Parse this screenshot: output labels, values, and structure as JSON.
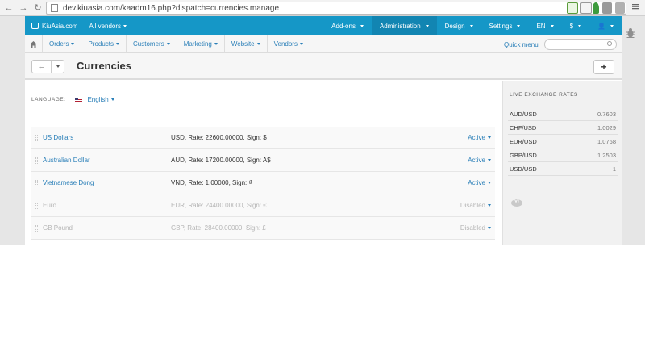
{
  "browser": {
    "url": "dev.kiuasia.com/kaadm16.php?dispatch=currencies.manage",
    "back_glyph": "←",
    "forward_glyph": "→",
    "reload_glyph": "↻"
  },
  "topbar": {
    "store_name": "KiuAsia.com",
    "vendors_label": "All vendors",
    "menus": [
      {
        "label": "Add-ons"
      },
      {
        "label": "Administration"
      },
      {
        "label": "Design"
      },
      {
        "label": "Settings"
      },
      {
        "label": "EN"
      },
      {
        "label": "$"
      },
      {
        "label": "👤"
      }
    ],
    "active_color": "#1285b2",
    "bar_color": "#1597c7"
  },
  "subnav": {
    "items": [
      {
        "label": "Orders"
      },
      {
        "label": "Products"
      },
      {
        "label": "Customers"
      },
      {
        "label": "Marketing"
      },
      {
        "label": "Website"
      },
      {
        "label": "Vendors"
      }
    ],
    "quick_menu": "Quick menu"
  },
  "page": {
    "title": "Currencies",
    "back_glyph": "←",
    "add_glyph": "+"
  },
  "language": {
    "label": "LANGUAGE:",
    "value": "English"
  },
  "currencies": [
    {
      "name": "US Dollars",
      "details": "USD, Rate: 22600.00000, Sign: $",
      "status": "Active"
    },
    {
      "name": "Australian Dollar",
      "details": "AUD, Rate: 17200.00000, Sign: A$",
      "status": "Active"
    },
    {
      "name": "Vietnamese Dong",
      "details": "VND, Rate: 1.00000, Sign: ₫",
      "status": "Active"
    },
    {
      "name": "Euro",
      "details": "EUR, Rate: 24400.00000, Sign: €",
      "status": "Disabled"
    },
    {
      "name": "GB Pound",
      "details": "GBP, Rate: 28400.00000, Sign: £",
      "status": "Disabled"
    }
  ],
  "sidebar": {
    "heading": "LIVE EXCHANGE RATES",
    "rates": [
      {
        "pair": "AUD/USD",
        "value": "0.7603"
      },
      {
        "pair": "CHF/USD",
        "value": "1.0029"
      },
      {
        "pair": "EUR/USD",
        "value": "1.0768"
      },
      {
        "pair": "GBP/USD",
        "value": "1.2503"
      },
      {
        "pair": "USD/USD",
        "value": "1"
      }
    ],
    "provider_mark": "Y!"
  }
}
